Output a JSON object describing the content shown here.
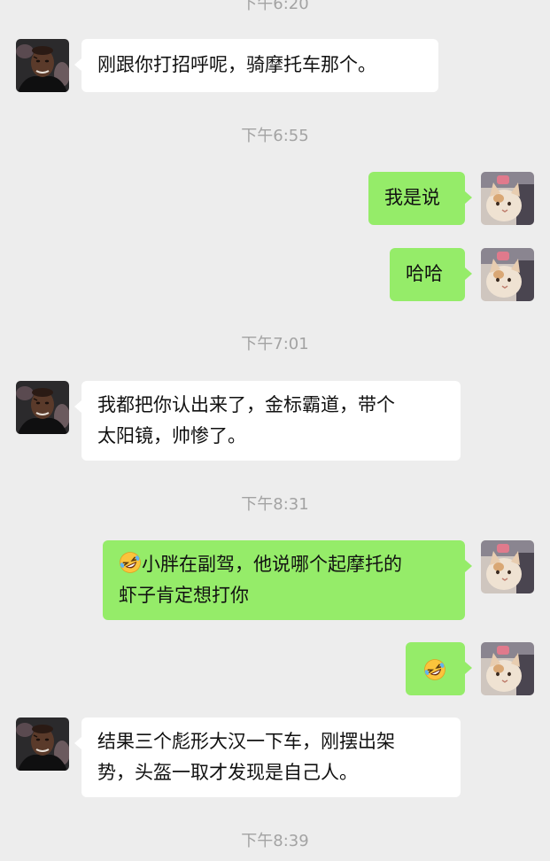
{
  "chat": {
    "timestamps": [
      "下午6:20",
      "下午6:55",
      "下午7:01",
      "下午8:31",
      "下午8:39"
    ],
    "messages": [
      {
        "sender": "friend",
        "avatar": "boxer-avatar",
        "text": "刚跟你打招呼呢，骑摩托车那个。"
      },
      {
        "sender": "me",
        "avatar": "cat-avatar",
        "text": "我是说"
      },
      {
        "sender": "me",
        "avatar": "cat-avatar",
        "text": "哈哈"
      },
      {
        "sender": "friend",
        "avatar": "boxer-avatar",
        "lines": [
          "我都把你认出来了，金标霸道，带个",
          "太阳镜，帅惨了。"
        ]
      },
      {
        "sender": "me",
        "avatar": "cat-avatar",
        "emoji": "rolling-laughing-emoji",
        "lines": [
          "小胖在副驾，他说哪个起摩托的",
          "虾子肯定想打你"
        ]
      },
      {
        "sender": "me",
        "avatar": "cat-avatar",
        "emoji": "rolling-laughing-emoji"
      },
      {
        "sender": "friend",
        "avatar": "boxer-avatar",
        "lines": [
          "结果三个彪形大汉一下车，刚摆出架",
          "势，头盔一取才发现是自己人。"
        ]
      }
    ]
  },
  "colors": {
    "background": "#ededed",
    "incoming_bubble": "#ffffff",
    "outgoing_bubble": "#95ec69",
    "timestamp": "#a3a3a3"
  }
}
